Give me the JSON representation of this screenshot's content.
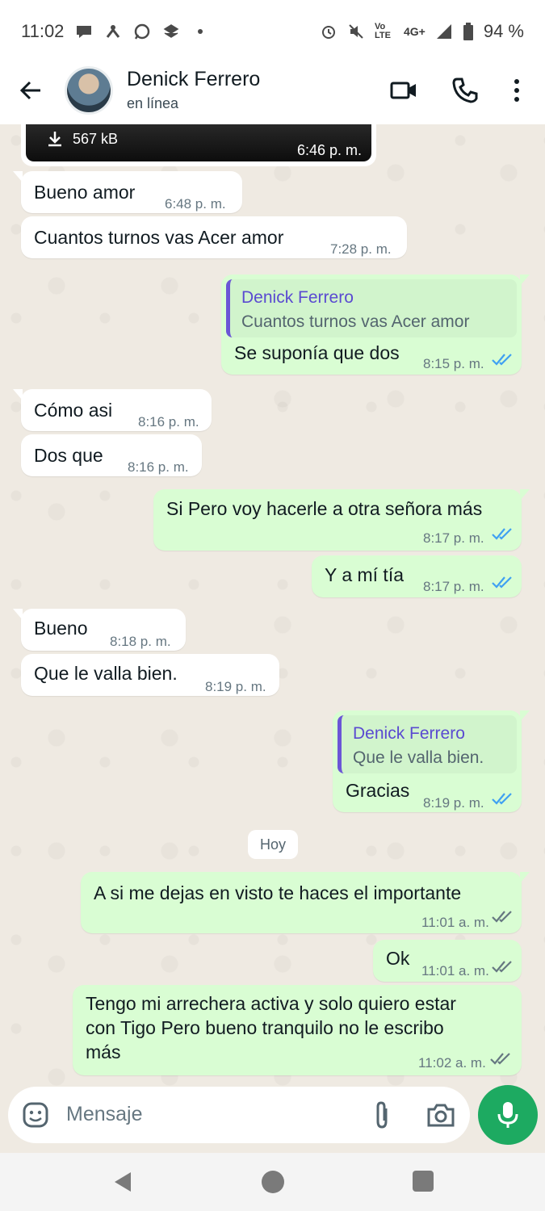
{
  "status_bar": {
    "time": "11:02",
    "network": "4G+",
    "volte": "Vo LTE",
    "battery": "94 %"
  },
  "header": {
    "name": "Denick Ferrero",
    "status": "en línea"
  },
  "media": {
    "size": "567 kB",
    "time": "6:46 p. m."
  },
  "messages": [
    {
      "text": "Bueno amor",
      "time": "6:48 p. m."
    },
    {
      "text": "Cuantos turnos vas Acer amor",
      "time": "7:28 p. m."
    },
    {
      "quote_name": "Denick Ferrero",
      "quote_text": "Cuantos turnos vas Acer amor",
      "text": "Se suponía que dos",
      "time": "8:15 p. m."
    },
    {
      "text": "Cómo asi",
      "time": "8:16 p. m."
    },
    {
      "text": "Dos que",
      "time": "8:16 p. m."
    },
    {
      "text": "Si Pero voy hacerle a otra señora más",
      "time": "8:17 p. m."
    },
    {
      "text": "Y a mí tía",
      "time": "8:17 p. m."
    },
    {
      "text": "Bueno",
      "time": "8:18 p. m."
    },
    {
      "text": "Que le valla bien.",
      "time": "8:19 p. m."
    },
    {
      "quote_name": "Denick Ferrero",
      "quote_text": "Que le valla bien.",
      "text": "Gracias",
      "time": "8:19 p. m."
    },
    {
      "text": "A si me dejas en visto te haces el importante",
      "time": "11:01 a. m."
    },
    {
      "text": "Ok",
      "time": "11:01 a. m."
    },
    {
      "lines": [
        "Tengo mi arrechera activa y solo quiero estar",
        "con Tigo Pero bueno tranquilo no le escribo",
        "más"
      ],
      "time": "11:02 a. m."
    }
  ],
  "day_separator": "Hoy",
  "input": {
    "placeholder": "Mensaje"
  },
  "colors": {
    "read_ticks": "#3fa0f2",
    "sent_ticks": "#667781",
    "accent": "#1daa61"
  }
}
